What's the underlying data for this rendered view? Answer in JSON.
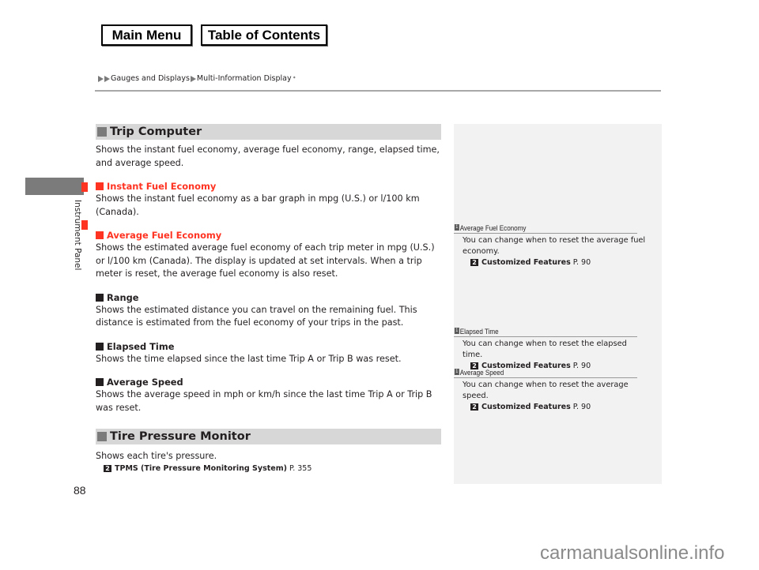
{
  "nav": {
    "main_menu": "Main Menu",
    "table_of_contents": "Table of Contents"
  },
  "breadcrumb": {
    "items": [
      "Gauges and Displays",
      "Multi-Information Display"
    ],
    "asterisk": "*"
  },
  "side_tab": {
    "label": "Instrument Panel",
    "accent_color": "#ff3322"
  },
  "sections": [
    {
      "title": "Trip Computer",
      "intro": "Shows the instant fuel economy, average fuel economy, range, elapsed time, and average speed.",
      "subsections": [
        {
          "title": "Instant Fuel Economy",
          "highlight": true,
          "text": "Shows the instant fuel economy as a bar graph in mpg (U.S.) or l/100 km (Canada)."
        },
        {
          "title": "Average Fuel Economy",
          "highlight": true,
          "text": "Shows the estimated average fuel economy of each trip meter in mpg (U.S.) or l/100 km (Canada). The display is updated at set intervals. When a trip meter is reset, the average fuel economy is also reset."
        },
        {
          "title": "Range",
          "highlight": false,
          "text": "Shows the estimated distance you can travel on the remaining fuel. This distance is estimated from the fuel economy of your trips in the past."
        },
        {
          "title": "Elapsed Time",
          "highlight": false,
          "text": "Shows the time elapsed since the last time Trip A or Trip B was reset."
        },
        {
          "title": "Average Speed",
          "highlight": false,
          "text": "Shows the average speed in mph or km/h since the last time Trip A or Trip B was reset."
        }
      ]
    },
    {
      "title": "Tire Pressure Monitor",
      "intro": "Shows each tire's pressure.",
      "xref": {
        "label": "TPMS (Tire Pressure Monitoring System)",
        "page": "P. 355"
      }
    }
  ],
  "notes": [
    {
      "title": "Average Fuel Economy",
      "text": "You can change when to reset the average fuel economy.",
      "xref": {
        "label": "Customized Features",
        "page": "P. 90"
      }
    },
    {
      "title": "Elapsed Time",
      "text": "You can change when to reset the elapsed time.",
      "xref": {
        "label": "Customized Features",
        "page": "P. 90"
      }
    },
    {
      "title": "Average Speed",
      "text": "You can change when to reset the average speed.",
      "xref": {
        "label": "Customized Features",
        "page": "P. 90"
      }
    }
  ],
  "icons": {
    "note_icon": "1",
    "xref_icon": "2"
  },
  "page_number": "88",
  "watermark": "carmanualsonline.info"
}
